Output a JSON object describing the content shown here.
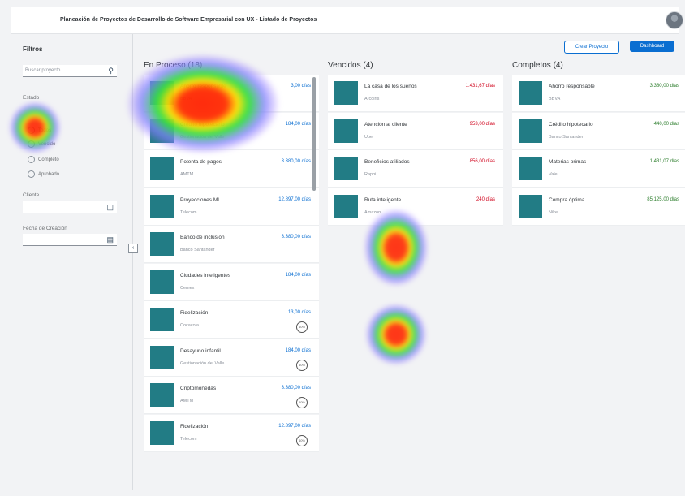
{
  "header": {
    "title": "Planeación de Proyectos de Desarrollo de Software Empresarial con UX - Listado de Proyectos"
  },
  "filters": {
    "title": "Filtros",
    "search_placeholder": "Buscar proyecto",
    "state_label": "Estado",
    "state_options": [
      "Todos",
      "Vencido",
      "Completo",
      "Aprobado"
    ],
    "client_label": "Cliente",
    "date_label": "Fecha de Creación"
  },
  "actions": {
    "create": "Crear Proyecto",
    "dashboard": "Dashboard"
  },
  "columns": [
    {
      "title": "En Proceso (18)",
      "cards": [
        {
          "name": "Ahorro responsable",
          "client": "BBVA",
          "days": "3,00 días",
          "color": "blue"
        },
        {
          "name": "Crédito hipotecario",
          "client": "Gestionación del Valle",
          "days": "184,00 días",
          "color": "blue"
        },
        {
          "name": "Potenta de pagos",
          "client": "AMTM",
          "days": "3.380,00 días",
          "color": "blue"
        },
        {
          "name": "Proyecciones ML",
          "client": "Telecom",
          "days": "12.897,00 días",
          "color": "blue"
        },
        {
          "name": "Banco de inclusión",
          "client": "Banco Santander",
          "days": "3.380,00 días",
          "color": "blue"
        },
        {
          "name": "Ciudades inteligentes",
          "client": "Cemex",
          "days": "184,00 días",
          "color": "blue"
        },
        {
          "name": "Fidelización",
          "client": "Cocacola",
          "days": "13,00 días",
          "color": "blue",
          "ring": "40%"
        },
        {
          "name": "Desayuno infantil",
          "client": "Gestionación del Valle",
          "days": "184,00 días",
          "color": "blue",
          "ring": "40%"
        },
        {
          "name": "Criptomonedas",
          "client": "AMTM",
          "days": "3.380,00 días",
          "color": "blue",
          "ring": "40%"
        },
        {
          "name": "Fidelización",
          "client": "Telecom",
          "days": "12.897,00 días",
          "color": "blue",
          "ring": "40%"
        }
      ]
    },
    {
      "title": "Vencidos (4)",
      "cards": [
        {
          "name": "La casa de los sueños",
          "client": "Arcoiris",
          "days": "1.431,67 días",
          "color": "red"
        },
        {
          "name": "Atención al cliente",
          "client": "Uber",
          "days": "953,00 días",
          "color": "red"
        },
        {
          "name": "Beneficios afiliados",
          "client": "Rappi",
          "days": "856,00 días",
          "color": "red"
        },
        {
          "name": "Ruta inteligente",
          "client": "Amazon",
          "days": "240 días",
          "color": "red"
        }
      ]
    },
    {
      "title": "Completos (4)",
      "cards": [
        {
          "name": "Ahorro responsable",
          "client": "BBVA",
          "days": "3.380,00 días",
          "color": "green"
        },
        {
          "name": "Crédito hipotecario",
          "client": "Banco Santander",
          "days": "440,00 días",
          "color": "green"
        },
        {
          "name": "Materias primas",
          "client": "Vale",
          "days": "1.431,07 días",
          "color": "green"
        },
        {
          "name": "Compra óptima",
          "client": "Nike",
          "days": "85.125,00 días",
          "color": "green"
        }
      ]
    }
  ]
}
